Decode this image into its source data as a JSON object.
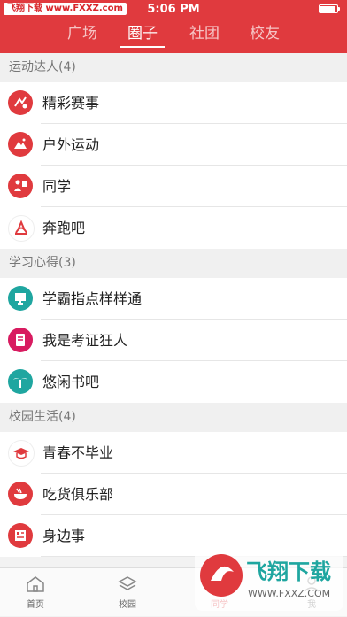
{
  "status_bar": {
    "watermark_text": "飞翔下载 www.FXXZ.com",
    "time": "5:06 PM"
  },
  "top_tabs": [
    {
      "label": "广场",
      "active": false
    },
    {
      "label": "圈子",
      "active": true
    },
    {
      "label": "社团",
      "active": false
    },
    {
      "label": "校友",
      "active": false
    }
  ],
  "sections": [
    {
      "title": "运动达人(4)",
      "items": [
        {
          "label": "精彩赛事",
          "icon": "event-icon",
          "color": "#e03a3e"
        },
        {
          "label": "户外运动",
          "icon": "mountain-icon",
          "color": "#e03a3e"
        },
        {
          "label": "同学",
          "icon": "classmates-icon",
          "color": "#e03a3e"
        },
        {
          "label": "奔跑吧",
          "icon": "running-icon",
          "color": "#e03a3e"
        }
      ]
    },
    {
      "title": "学习心得(3)",
      "items": [
        {
          "label": "学霸指点样样通",
          "icon": "teacher-board-icon",
          "color": "#1fa6a0"
        },
        {
          "label": "我是考证狂人",
          "icon": "certificate-icon",
          "color": "#d81b60"
        },
        {
          "label": "悠闲书吧",
          "icon": "palm-tree-icon",
          "color": "#1fa6a0"
        }
      ]
    },
    {
      "title": "校园生活(4)",
      "items": [
        {
          "label": "青春不毕业",
          "icon": "graduation-cap-icon",
          "color": "#e03a3e"
        },
        {
          "label": "吃货俱乐部",
          "icon": "food-bowl-icon",
          "color": "#e03a3e"
        },
        {
          "label": "身边事",
          "icon": "news-icon",
          "color": "#e03a3e"
        }
      ]
    }
  ],
  "bottom_tabs": [
    {
      "label": "首页",
      "icon": "home-icon",
      "active": false
    },
    {
      "label": "校园",
      "icon": "layers-icon",
      "active": false
    },
    {
      "label": "同学",
      "icon": "classmates-tab-icon",
      "active": true
    },
    {
      "label": "我",
      "icon": "profile-icon",
      "active": false
    }
  ],
  "watermark": {
    "title": "飞翔下载",
    "url": "WWW.FXXZ.COM"
  },
  "colors": {
    "brand_red": "#e03a3e",
    "teal": "#1fa6a0",
    "pink": "#d81b60"
  }
}
